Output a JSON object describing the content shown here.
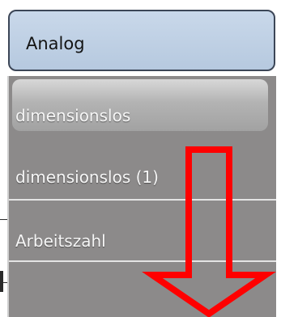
{
  "selector": {
    "value": "Analog"
  },
  "dropdown": {
    "options": [
      {
        "label": "dimensionslos",
        "selected": true
      },
      {
        "label": "dimensionslos (1)",
        "selected": false
      },
      {
        "label": "Arbeitszahl",
        "selected": false
      },
      {
        "label": "",
        "selected": false
      }
    ]
  },
  "annotation": {
    "icon": "scroll-down-arrow-icon",
    "color": "#ff0000"
  },
  "colors": {
    "header_top": "#c9d8ea",
    "list_background": "#8c8a8a",
    "option_text": "#f6f6f6"
  }
}
